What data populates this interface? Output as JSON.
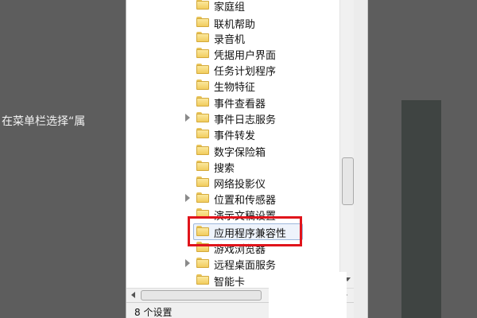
{
  "background_text": "在菜单栏选择“属",
  "tree": {
    "items": [
      {
        "label": "家庭组",
        "expandable": false
      },
      {
        "label": "联机帮助",
        "expandable": false
      },
      {
        "label": "录音机",
        "expandable": false
      },
      {
        "label": "凭据用户界面",
        "expandable": false
      },
      {
        "label": "任务计划程序",
        "expandable": false
      },
      {
        "label": "生物特征",
        "expandable": false
      },
      {
        "label": "事件查看器",
        "expandable": false
      },
      {
        "label": "事件日志服务",
        "expandable": true
      },
      {
        "label": "事件转发",
        "expandable": false
      },
      {
        "label": "数字保险箱",
        "expandable": false
      },
      {
        "label": "搜索",
        "expandable": false
      },
      {
        "label": "网络投影仪",
        "expandable": false
      },
      {
        "label": "位置和传感器",
        "expandable": true
      },
      {
        "label": "演示文稿设置",
        "expandable": false
      },
      {
        "label": "应用程序兼容性",
        "expandable": false,
        "selected": true
      },
      {
        "label": "游戏浏览器",
        "expandable": false
      },
      {
        "label": "远程桌面服务",
        "expandable": true
      },
      {
        "label": "智能卡",
        "expandable": false
      }
    ]
  },
  "status_bar": {
    "text": "8 个设置"
  },
  "colors": {
    "highlight_box": "#e0141b",
    "folder": "#f1cc5d",
    "selection": "#eef3fb"
  }
}
